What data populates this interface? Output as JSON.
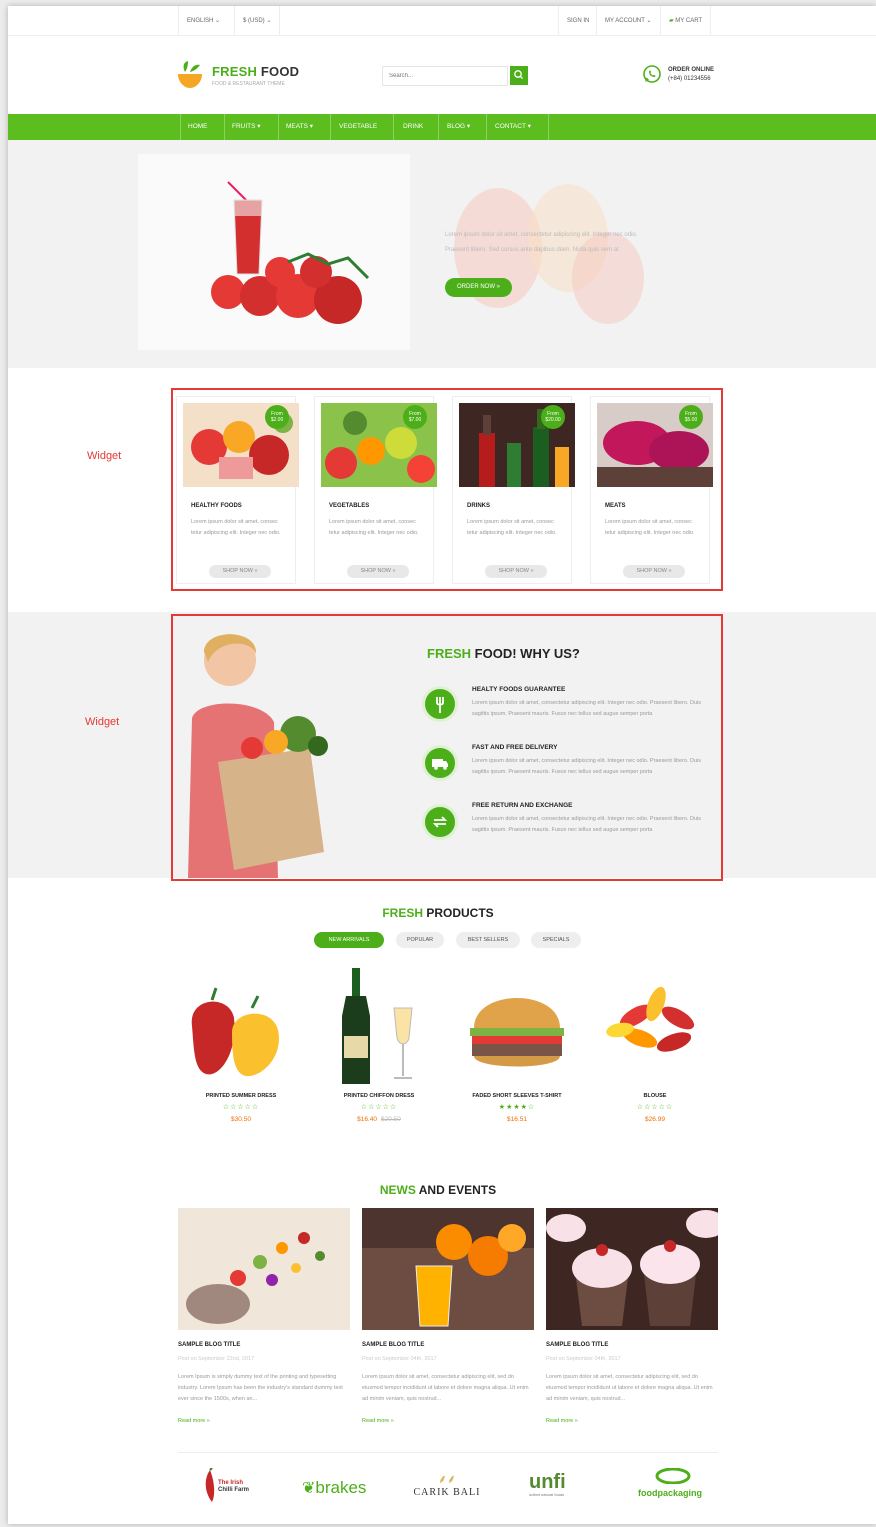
{
  "topbar": {
    "language": "ENGLISH",
    "currency": "$ (USD)",
    "sign_in": "SIGN IN",
    "account": "MY ACCOUNT",
    "cart": "MY CART"
  },
  "header": {
    "brand_a": "FRESH",
    "brand_b": " FOOD",
    "tagline": "FOOD & RESTAURANT THEME",
    "search_placeholder": "Search...",
    "order_label": "ORDER ONLINE",
    "order_phone": "(+84) 01234556"
  },
  "nav": [
    "HOME",
    "FRUITS ▾",
    "MEATS ▾",
    "VEGETABLE",
    "DRINK",
    "BLOG ▾",
    "CONTACT ▾"
  ],
  "hero": {
    "text": "Lorem ipsum dolor sit amet, consectetur adipiscing elit. Integer nec odio. Praesent libero. Sed cursus ante dapibus diam. Nulla quis sem at",
    "button": "ORDER NOW »"
  },
  "widget_label": "Widget",
  "categories": [
    {
      "title": "HEALTHY FOODS",
      "badge_from": "From",
      "badge_price": "$2.00",
      "desc": "Lorem ipsum dolor sit amet, consec tetur adipiscing elit. Integer nec odio.",
      "button": "SHOP NOW »"
    },
    {
      "title": "VEGETABLES",
      "badge_from": "From",
      "badge_price": "$7.00",
      "desc": "Lorem ipsum dolor sit amet, consec tetur adipiscing elit. Integer nec odio.",
      "button": "SHOP NOW »"
    },
    {
      "title": "DRINKS",
      "badge_from": "From",
      "badge_price": "$20.00",
      "desc": "Lorem ipsum dolor sit amet, consec tetur adipiscing elit. Integer nec odio.",
      "button": "SHOP NOW »"
    },
    {
      "title": "MEATS",
      "badge_from": "From",
      "badge_price": "$5.00",
      "desc": "Lorem ipsum dolor sit amet, consec tetur adipiscing elit. Integer nec odio.",
      "button": "SHOP NOW »"
    }
  ],
  "why": {
    "title_a": "FRESH",
    "title_b": " FOOD! WHY US?",
    "features": [
      {
        "title": "HEALTY FOODS GUARANTEE",
        "desc": "Lorem ipsum dolor sit amet, consectetur adipiscing elit. Integer nec odio. Praesent libero. Duis sagittis ipsum. Praesent mauris. Fusce nec tellus sed augue semper porta",
        "icon": "cutlery-icon"
      },
      {
        "title": "FAST AND FREE DELIVERY",
        "desc": "Lorem ipsum dolor sit amet, consectetur adipiscing elit. Integer nec odio. Praesent libero. Duis sagittis ipsum. Praesent mauris. Fusce nec tellus sed augue semper porta",
        "icon": "truck-icon"
      },
      {
        "title": "FREE RETURN AND EXCHANGE",
        "desc": "Lorem ipsum dolor sit amet, consectetur adipiscing elit. Integer nec odio. Praesent libero. Duis sagittis ipsum. Praesent mauris. Fusce nec tellus sed augue semper porta",
        "icon": "exchange-icon"
      }
    ]
  },
  "products": {
    "title_a": "FRESH",
    "title_b": " PRODUCTS",
    "tabs": [
      "NEW ARRIVALS",
      "POPULAR",
      "BEST SELLERS",
      "SPECIALS"
    ],
    "active_tab": "NEW ARRIVALS",
    "items": [
      {
        "name": "PRINTED SUMMER DRESS",
        "stars": "☆☆☆☆☆",
        "price": "$30.50",
        "old": ""
      },
      {
        "name": "PRINTED CHIFFON DRESS",
        "stars": "☆☆☆☆☆",
        "price": "$16.40",
        "old": "$20.50"
      },
      {
        "name": "FADED SHORT SLEEVES T-SHIRT",
        "stars": "★★★★☆",
        "price": "$16.51",
        "old": ""
      },
      {
        "name": "BLOUSE",
        "stars": "☆☆☆☆☆",
        "price": "$26.99",
        "old": ""
      }
    ]
  },
  "news": {
    "title_a": "NEWS",
    "title_b": " AND EVENTS",
    "posts": [
      {
        "title": "SAMPLE BLOG TITLE",
        "date": "Post on September 22nd, 2017",
        "text": "Lorem Ipsum is simply dummy text of the printing and typesetting industry. Lorem Ipsum has been the industry's standard dummy text ever since the 1500s, when an...",
        "more": "Read more »"
      },
      {
        "title": "SAMPLE BLOG TITLE",
        "date": "Post on September 04th, 2017",
        "text": "Lorem ipsum dolor sit amet, consectetur adipiscing elit, sed do eiusmod tempor incididunt ut labore et dolore magna aliqua. Ut enim ad minim veniam, quis nostrud...",
        "more": "Read more »"
      },
      {
        "title": "SAMPLE BLOG TITLE",
        "date": "Post on September 04th, 2017",
        "text": "Lorem ipsum dolor sit amet, consectetur adipiscing elit, sed do eiusmod tempor incididunt ut labore et dolore magna aliqua. Ut enim ad minim veniam, quis nostrud...",
        "more": "Read more »"
      }
    ]
  },
  "brands": {
    "irish_a": "The Irish",
    "irish_b": "Chilli Farm",
    "brakes": "brakes",
    "carik": "CARIK BALI",
    "unfi": "unfi",
    "unfi_sub": "united natural foods",
    "foodpack": "foodpackaging"
  },
  "colors": {
    "accent": "#4caf1a",
    "nav": "#5bbd1e",
    "annotation": "#e53935",
    "price": "#ef6c00"
  }
}
